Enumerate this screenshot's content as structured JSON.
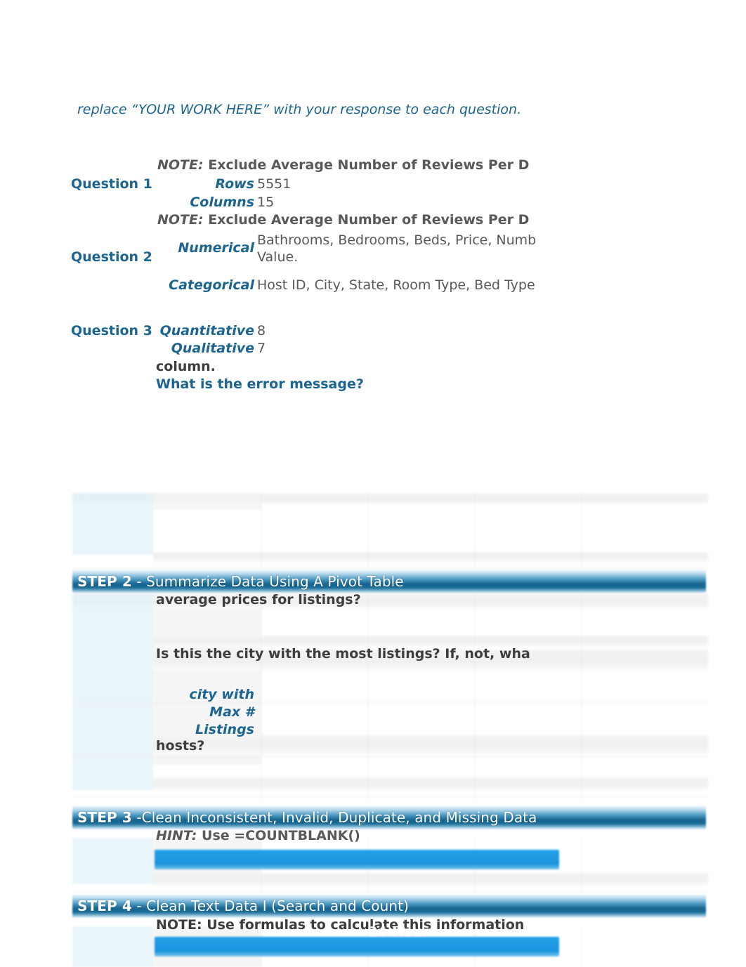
{
  "document": {
    "intro_line": "replace “YOUR WORK HERE” with your response to each question."
  },
  "questions": [
    {
      "id": "question-1",
      "heading": "Question 1",
      "note": {
        "prefix": "NOTE:",
        "text": "Exclude Average Number of Reviews Per D"
      },
      "fields": [
        {
          "label": "Rows",
          "value": "5551"
        },
        {
          "label": "Columns",
          "value": "15"
        }
      ]
    },
    {
      "id": "question-2",
      "heading": "Question 2",
      "note": {
        "prefix": "NOTE:",
        "text": "Exclude Average Number of Reviews Per D"
      },
      "fields": [
        {
          "label": "Numerical",
          "value": "Bathrooms, Bedrooms, Beds, Price, Numb Value."
        },
        {
          "label": "Categorical",
          "value": "Host ID, City, State, Room Type, Bed Type"
        }
      ]
    },
    {
      "id": "question-3",
      "heading": "Question 3",
      "fields": [
        {
          "label": "Quantitative",
          "value": "8"
        },
        {
          "label": "Qualitative",
          "value": "7"
        }
      ],
      "trailing": [
        {
          "text": "column.",
          "style": "dark"
        },
        {
          "text": "What is the error message?",
          "style": "blue"
        }
      ]
    }
  ],
  "steps": [
    {
      "id": "step-2",
      "number": "STEP 2",
      "title": " - Summarize Data Using A Pivot Table",
      "prompts": [
        {
          "text": "average prices for listings?",
          "style": "dark"
        },
        {
          "text": "Is this the city with the most listings? If, not, wha",
          "style": "dark"
        },
        {
          "text": "hosts?",
          "style": "dark"
        }
      ],
      "labels": [
        {
          "text": "city with"
        },
        {
          "text": "Max #"
        },
        {
          "text": "Listings"
        }
      ]
    },
    {
      "id": "step-3",
      "number": "STEP 3",
      "title": " -Clean Inconsistent, Invalid, Duplicate, and Missing Data",
      "hint": {
        "prefix": "HINT:",
        "text": "Use =COUNTBLANK()"
      }
    },
    {
      "id": "step-4",
      "number": "STEP 4",
      "title": " - Clean Text Data I (Search and Count)",
      "note_line": "NOTE: Use formulas to calculate this information",
      "overlay_text": "24-Hour"
    }
  ],
  "colors": {
    "accent_blue": "#1c6590",
    "banner_dark": "#15648f",
    "answer_bar_blue": "#1a93dd",
    "body_grey": "#595959",
    "prompt_dark": "#3d3d3d",
    "ghost_left_col": "#ddeef8"
  }
}
